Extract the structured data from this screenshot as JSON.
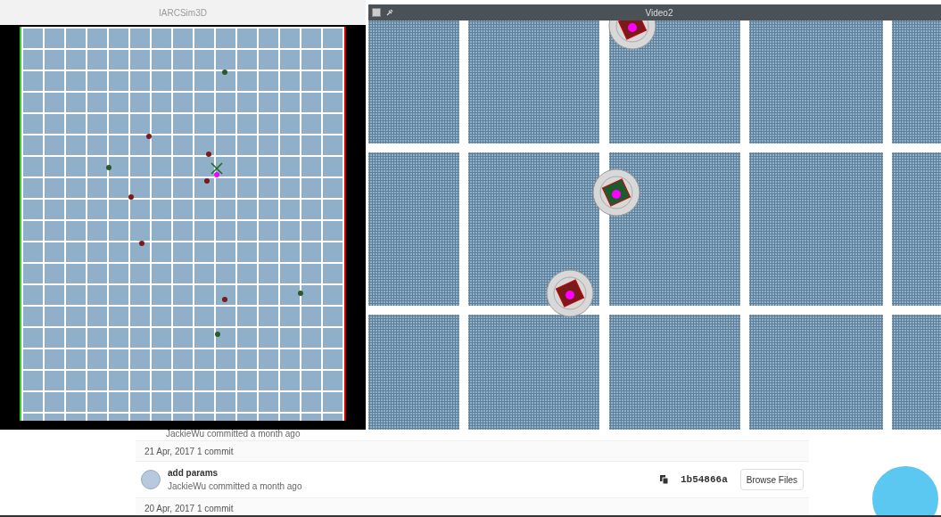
{
  "windows": [
    {
      "kind": "sim",
      "title": "IARCSim3D"
    },
    {
      "kind": "video",
      "title": "Video2"
    }
  ],
  "commits_page": {
    "partial_author": "JackieWu committed a month ago",
    "days": [
      {
        "header": "21 Apr, 2017 1 commit",
        "commits": [
          {
            "title": "add params",
            "author": "JackieWu committed a month ago",
            "sha": "1b54866a",
            "button": "Browse Files"
          }
        ]
      },
      {
        "header": "20 Apr, 2017 1 commit"
      }
    ]
  }
}
